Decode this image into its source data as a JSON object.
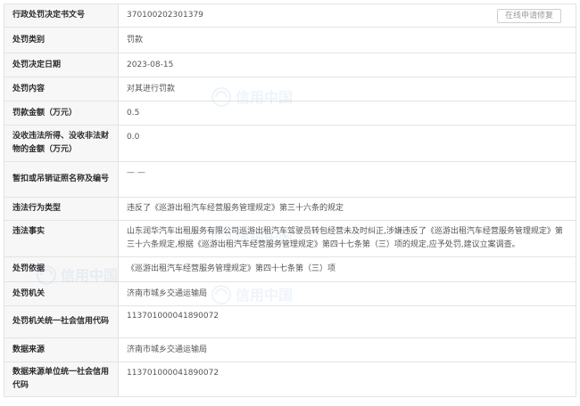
{
  "record": {
    "rows": [
      {
        "label": "行政处罚决定书文号",
        "value": "370100202301379",
        "button": "在线申请修复"
      },
      {
        "label": "处罚类别",
        "value": "罚款"
      },
      {
        "label": "处罚决定日期",
        "value": "2023-08-15"
      },
      {
        "label": "处罚内容",
        "value": "对其进行罚款"
      },
      {
        "label": "罚款金额（万元）",
        "value": "0.5"
      },
      {
        "label": "没收违法所得、没收非法财物的金额（万元）",
        "value": "0.0"
      },
      {
        "label": "暂扣或吊销证照名称及编号",
        "value": "— —"
      },
      {
        "label": "违法行为类型",
        "value": "违反了《巡游出租汽车经营服务管理规定》第三十六条的规定"
      },
      {
        "label": "违法事实",
        "value": "山东润华汽车出租服务有限公司巡游出租汽车驾驶员转包经营未及时纠正,涉嫌违反了《巡游出租汽车经营服务管理规定》第三十六条规定,根据《巡游出租汽车经营服务管理规定》第四十七条第（三）项的规定,应予处罚,建议立案调查。"
      },
      {
        "label": "处罚依据",
        "value": "《巡游出租汽车经营服务管理规定》第四十七条第（三）项"
      },
      {
        "label": "处罚机关",
        "value": "济南市城乡交通运输局"
      },
      {
        "label": "处罚机关统一社会信用代码",
        "value": "113701000041890072"
      },
      {
        "label": "数据来源",
        "value": "济南市城乡交通运输局"
      },
      {
        "label": "数据来源单位统一社会信用代码",
        "value": "113701000041890072"
      }
    ]
  },
  "watermark": {
    "text": "信用中国",
    "color": "#1a6fb5"
  }
}
